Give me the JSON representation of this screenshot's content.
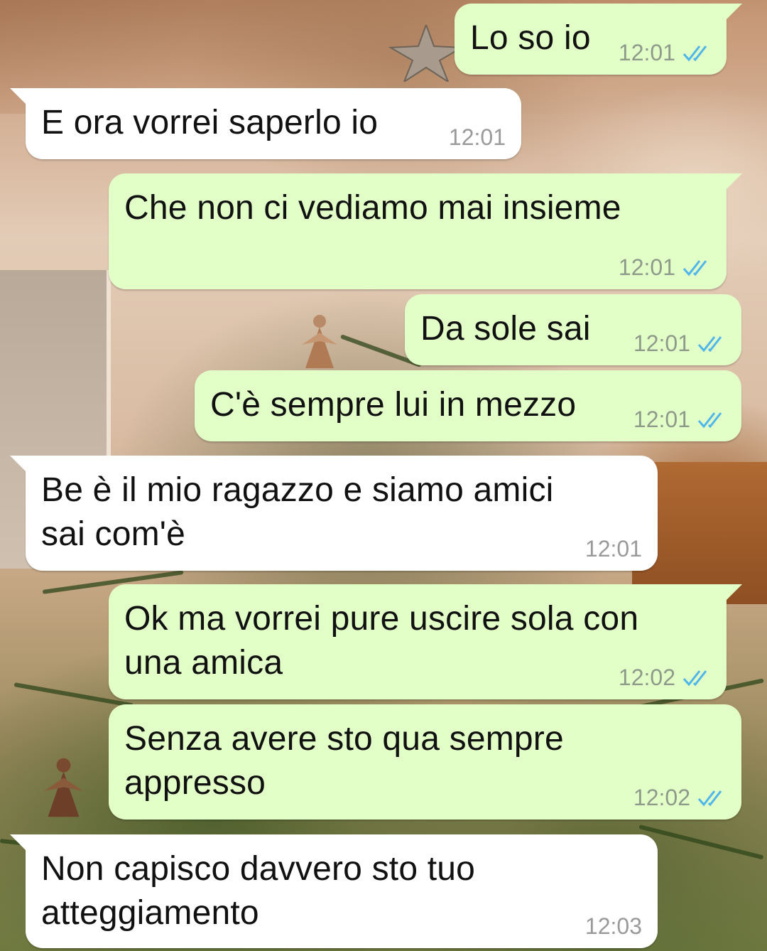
{
  "colors": {
    "outgoing_bubble": "#e2ffc7",
    "incoming_bubble": "#ffffff",
    "read_ticks": "#4fb6ec",
    "timestamp": "#8e9a8a"
  },
  "messages": [
    {
      "direction": "out",
      "text": "Lo so io",
      "time": "12:01",
      "status": "read"
    },
    {
      "direction": "in",
      "text": "E ora vorrei saperlo io",
      "time": "12:01"
    },
    {
      "direction": "out",
      "text": "Che non ci vediamo mai insieme",
      "time": "12:01",
      "status": "read"
    },
    {
      "direction": "out",
      "text": "Da sole sai",
      "time": "12:01",
      "status": "read"
    },
    {
      "direction": "out",
      "text": "C'è sempre lui in mezzo",
      "time": "12:01",
      "status": "read"
    },
    {
      "direction": "in",
      "text": "Be è il mio ragazzo e siamo amici\nsai com'è",
      "time": "12:01"
    },
    {
      "direction": "out",
      "text": "Ok ma vorrei pure uscire sola con\nuna amica",
      "time": "12:02",
      "status": "read"
    },
    {
      "direction": "out",
      "text": "Senza avere sto qua sempre\nappresso",
      "time": "12:02",
      "status": "read"
    },
    {
      "direction": "in",
      "text": "Non capisco davvero sto tuo\natteggiamento",
      "time": "12:03"
    }
  ]
}
